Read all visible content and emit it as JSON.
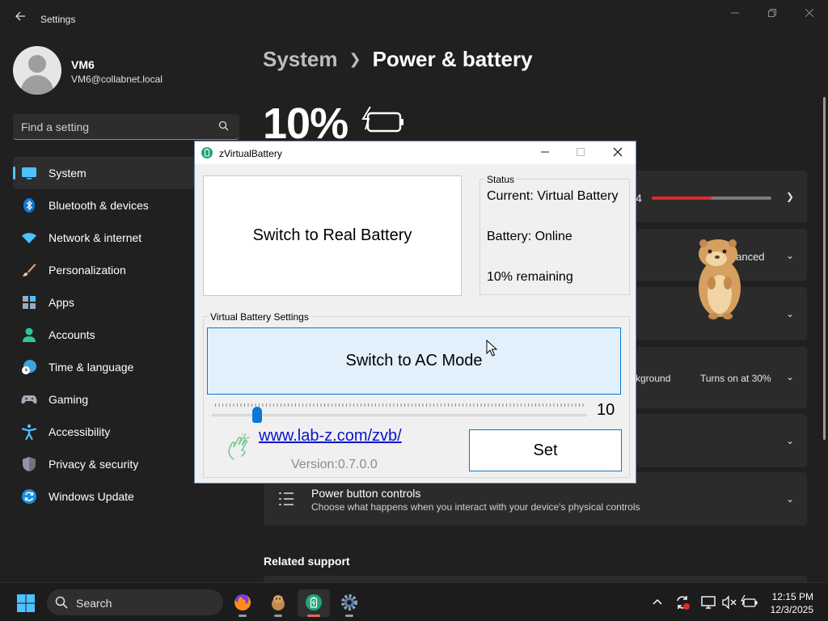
{
  "settings": {
    "app_title": "Settings",
    "profile": {
      "name": "VM6",
      "email": "VM6@collabnet.local"
    },
    "search": {
      "placeholder": "Find a setting"
    },
    "nav": [
      {
        "id": "system",
        "label": "System",
        "icon": "system-icon",
        "active": true
      },
      {
        "id": "bluetooth",
        "label": "Bluetooth & devices",
        "icon": "bluetooth-icon"
      },
      {
        "id": "network",
        "label": "Network & internet",
        "icon": "wifi-icon"
      },
      {
        "id": "personalization",
        "label": "Personalization",
        "icon": "brush-icon"
      },
      {
        "id": "apps",
        "label": "Apps",
        "icon": "apps-icon"
      },
      {
        "id": "accounts",
        "label": "Accounts",
        "icon": "person-icon"
      },
      {
        "id": "time",
        "label": "Time & language",
        "icon": "globe-clock-icon"
      },
      {
        "id": "gaming",
        "label": "Gaming",
        "icon": "gamepad-icon"
      },
      {
        "id": "accessibility",
        "label": "Accessibility",
        "icon": "accessibility-icon"
      },
      {
        "id": "privacy",
        "label": "Privacy & security",
        "icon": "shield-icon"
      },
      {
        "id": "update",
        "label": "Windows Update",
        "icon": "refresh-icon"
      }
    ],
    "breadcrumb": {
      "parent": "System",
      "current": "Power & battery"
    },
    "battery_percent": "10%",
    "battery_level_fraction": 0.5,
    "card_partial_number": "4",
    "power_mode_partial": "alanced",
    "saver_partial": "kground",
    "saver_value": "Turns on at 30%",
    "power_button": {
      "title": "Power button controls",
      "subtitle": "Choose what happens when you interact with your device's physical controls"
    },
    "related_support": "Related support"
  },
  "dialog": {
    "title": "zVirtualBattery",
    "switch_real_label": "Switch to Real Battery",
    "status": {
      "legend": "Status",
      "current": "Current: Virtual Battery",
      "battery": "Battery: Online",
      "remaining": "10% remaining"
    },
    "settings_group": {
      "legend": "Virtual Battery Settings",
      "switch_ac_label": "Switch to AC Mode",
      "slider_value": "10",
      "slider_fraction": 0.1,
      "link": "www.lab-z.com/zvb/",
      "version": "Version:0.7.0.0",
      "set_label": "Set"
    }
  },
  "taskbar": {
    "search_label": "Search",
    "time": "12:15 PM",
    "date": "12/3/2025"
  },
  "colors": {
    "accent": "#4cc2ff",
    "battery_bar": "#e0292b",
    "link": "#0a14c8",
    "button_border": "#0a78d4"
  }
}
